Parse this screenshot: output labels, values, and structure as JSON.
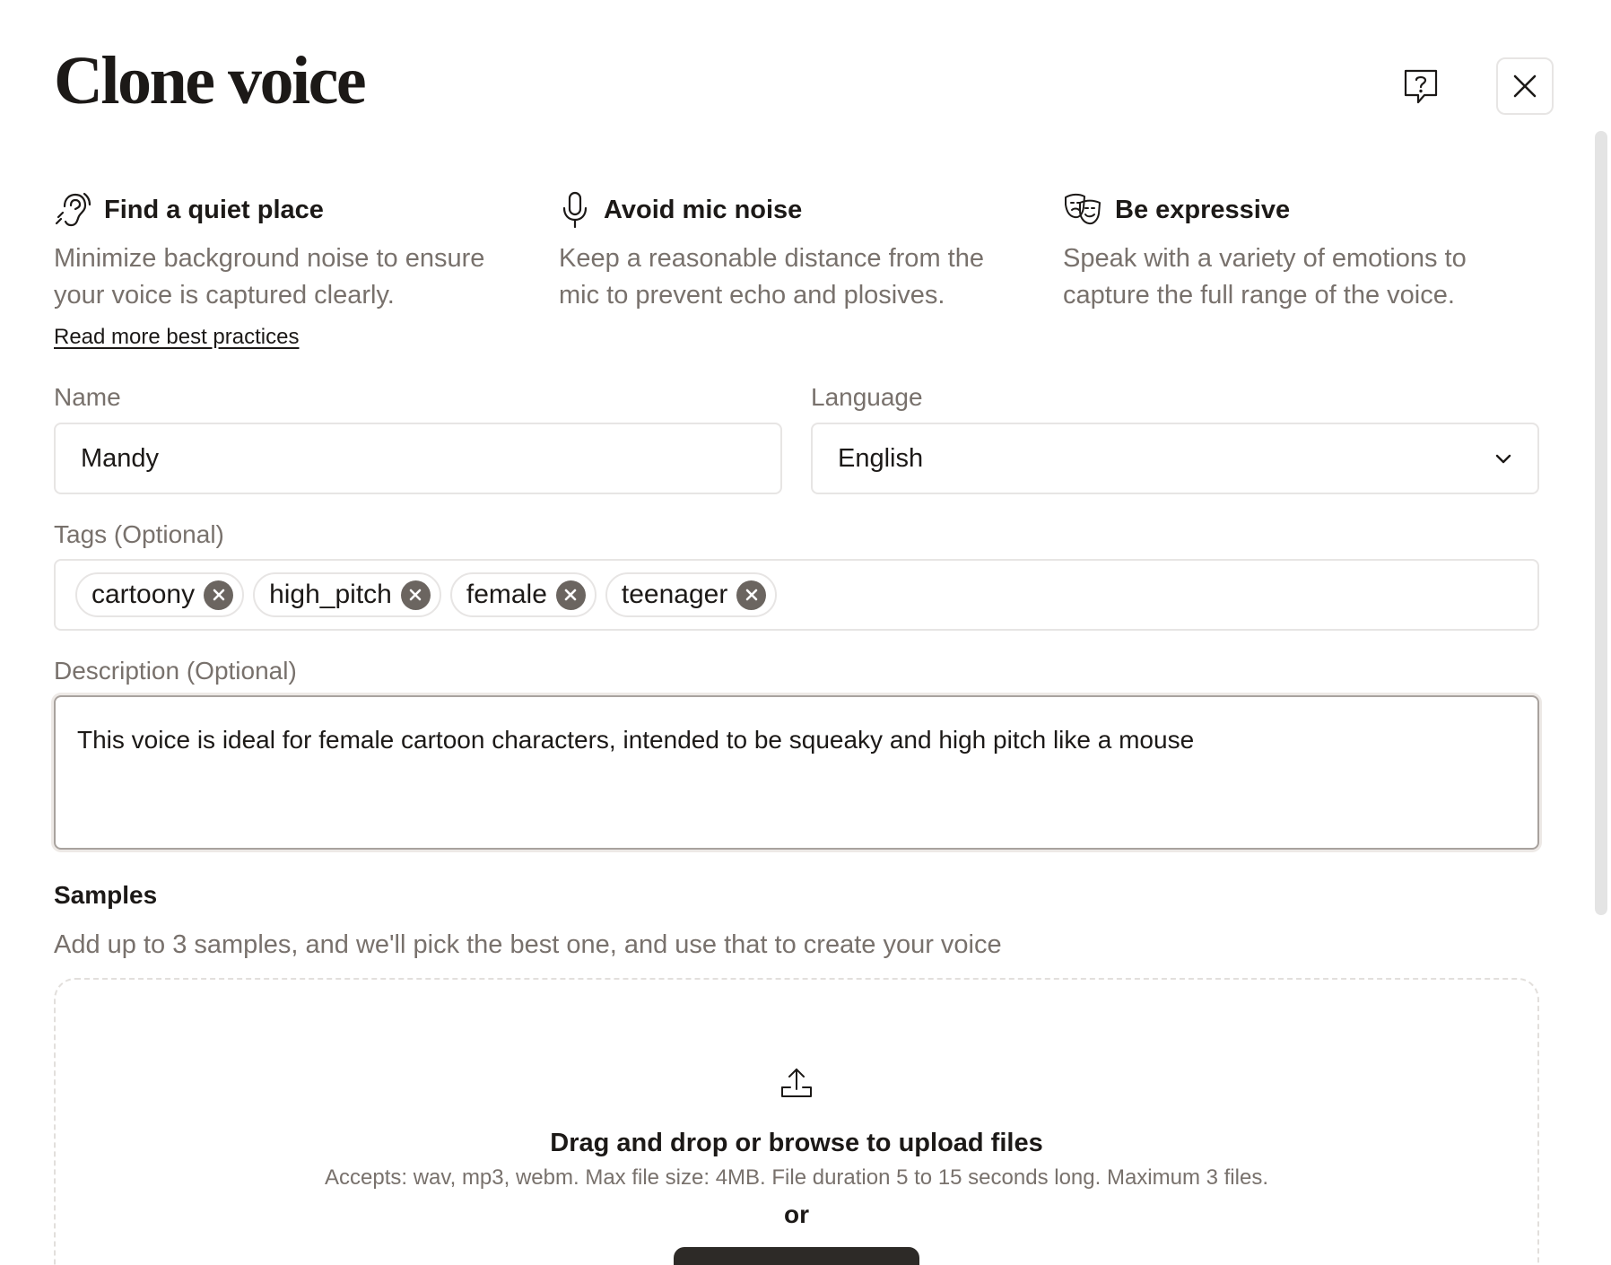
{
  "dialog": {
    "title": "Clone voice"
  },
  "tips": [
    {
      "icon": "ear-icon",
      "title": "Find a quiet place",
      "description": "Minimize background noise to ensure your voice is captured clearly."
    },
    {
      "icon": "microphone-icon",
      "title": "Avoid mic noise",
      "description": "Keep a reasonable distance from the mic to prevent echo and plosives."
    },
    {
      "icon": "theater-masks-icon",
      "title": "Be expressive",
      "description": "Speak with a variety of emotions to capture the full range of the voice."
    }
  ],
  "read_more_link": "Read more best practices",
  "form": {
    "name_label": "Name",
    "name_value": "Mandy",
    "language_label": "Language",
    "language_value": "English",
    "tags_label": "Tags (Optional)",
    "tags": [
      "cartoony",
      "high_pitch",
      "female",
      "teenager"
    ],
    "description_label": "Description (Optional)",
    "description_value": "This voice is ideal for female cartoon characters, intended to be squeaky and high pitch like a mouse"
  },
  "samples": {
    "title": "Samples",
    "description": "Add up to 3 samples, and we'll pick the best one, and use that to create your voice",
    "drop_title": "Drag and drop or browse to upload files",
    "drop_accepts": "Accepts: wav, mp3, webm. Max file size: 4MB. File duration 5 to 15 seconds long. Maximum 3 files.",
    "drop_or": "or"
  },
  "colors": {
    "text_primary": "#1c1917",
    "text_secondary": "#78716c",
    "border": "#e7e5e4",
    "tag_remove": "#6b6560",
    "button_dark": "#2d2a27"
  }
}
